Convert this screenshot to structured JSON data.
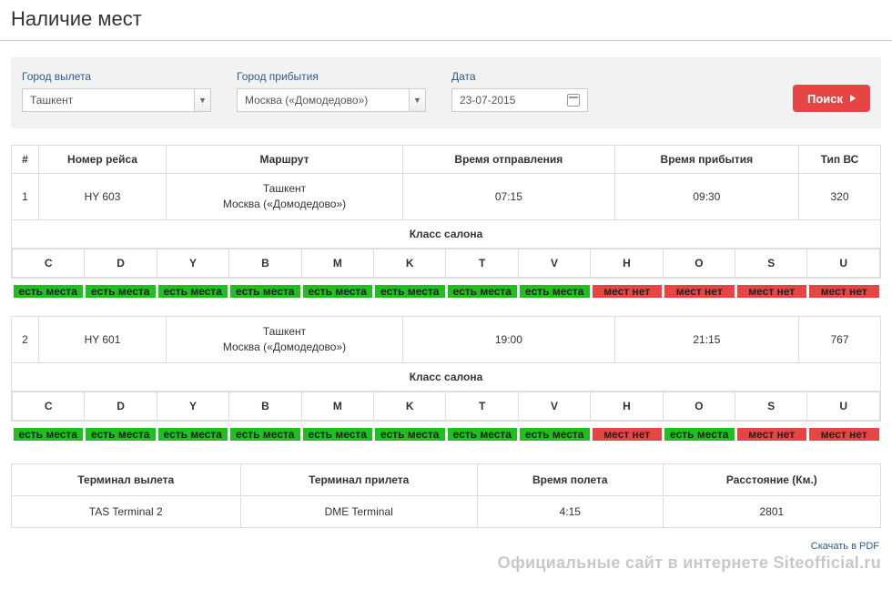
{
  "title": "Наличие мест",
  "search": {
    "departure_label": "Город вылета",
    "arrival_label": "Город прибытия",
    "date_label": "Дата",
    "departure_value": "Ташкент",
    "arrival_value": "Москва («Домодедово»)",
    "date_value": "23-07-2015",
    "search_btn": "Поиск"
  },
  "headers": {
    "num": "#",
    "flight": "Номер рейса",
    "route": "Маршрут",
    "dep_time": "Время отправления",
    "arr_time": "Время прибытия",
    "aircraft": "Тип ВС",
    "cabin_section": "Класс салона"
  },
  "classes": [
    "C",
    "D",
    "Y",
    "B",
    "M",
    "K",
    "T",
    "V",
    "H",
    "O",
    "S",
    "U"
  ],
  "avail_labels": {
    "yes": "есть места",
    "no": "мест нет"
  },
  "flights": [
    {
      "num": "1",
      "flight_no": "HY 603",
      "route1": "Ташкент",
      "route2": "Москва («Домодедово»)",
      "dep": "07:15",
      "arr": "09:30",
      "aircraft": "320",
      "avail": [
        "yes",
        "yes",
        "yes",
        "yes",
        "yes",
        "yes",
        "yes",
        "yes",
        "no",
        "no",
        "no",
        "no"
      ]
    },
    {
      "num": "2",
      "flight_no": "HY 601",
      "route1": "Ташкент",
      "route2": "Москва («Домодедово»)",
      "dep": "19:00",
      "arr": "21:15",
      "aircraft": "767",
      "avail": [
        "yes",
        "yes",
        "yes",
        "yes",
        "yes",
        "yes",
        "yes",
        "yes",
        "no",
        "yes",
        "no",
        "no"
      ]
    }
  ],
  "bottom": {
    "dep_term_hdr": "Терминал вылета",
    "arr_term_hdr": "Терминал прилета",
    "flight_time_hdr": "Время полета",
    "distance_hdr": "Расстояние (Км.)",
    "dep_term": "TAS Terminal 2",
    "arr_term": "DME Terminal",
    "flight_time": "4:15",
    "distance": "2801"
  },
  "pdf_link": "Скачать в PDF",
  "watermark": "Официальные сайт в интернете Siteofficial.ru"
}
